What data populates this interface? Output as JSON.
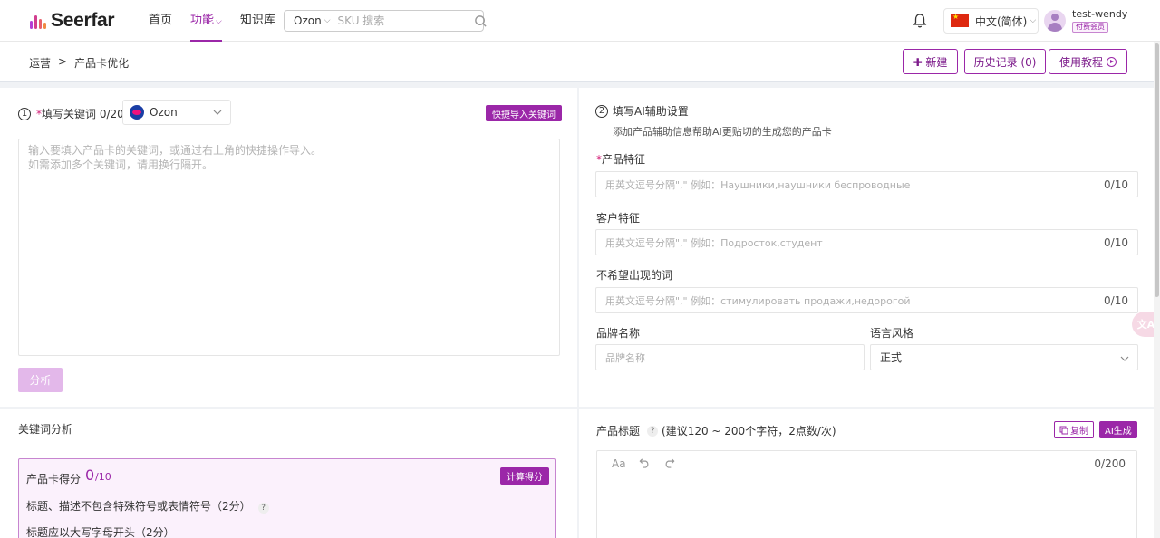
{
  "brand": {
    "name": "Seerfar",
    "colors": {
      "accent": "#9b27a8",
      "logo_bars": [
        "#b43fd6",
        "#d23e8f",
        "#e85f6b",
        "#f08a44"
      ]
    }
  },
  "nav": {
    "items": [
      {
        "label": "首页"
      },
      {
        "label": "功能"
      },
      {
        "label": "知识库"
      }
    ]
  },
  "search": {
    "platform": "Ozon",
    "placeholder": "SKU 搜索"
  },
  "lang": {
    "label": "中文(简体)"
  },
  "user": {
    "name": "test-wendy",
    "badge": "付费会员"
  },
  "breadcrumb": {
    "parent": "运营",
    "separator": ">",
    "current": "产品卡优化"
  },
  "actions": {
    "new": "✚ 新建",
    "history": "历史记录 (0)",
    "tutorial": "使用教程"
  },
  "keywords": {
    "step": "1",
    "required_mark": "*",
    "label": "填写关键词 0/20",
    "platform": "Ozon",
    "quick_import": "快捷导入关键词",
    "placeholder": "输入要填入产品卡的关键词，或通过右上角的快捷操作导入。\n如需添加多个关键词，请用换行隔开。",
    "analyze": "分析"
  },
  "ai_settings": {
    "step": "2",
    "title": "填写AI辅助设置",
    "subtitle": "添加产品辅助信息帮助AI更贴切的生成您的产品卡",
    "product_features": {
      "label": "产品特征",
      "placeholder": "用英文逗号分隔\",\"  例如：Наушники,наушники беспроводные",
      "counter": "0/10"
    },
    "customer_features": {
      "label": "客户特征",
      "placeholder": "用英文逗号分隔\",\"  例如：Подросток,студент",
      "counter": "0/10"
    },
    "unwanted_words": {
      "label": "不希望出现的词",
      "placeholder": "用英文逗号分隔\",\"  例如：стимулировать продажи,недорогой",
      "counter": "0/10"
    },
    "brand": {
      "label": "品牌名称",
      "placeholder": "品牌名称"
    },
    "style": {
      "label": "语言风格",
      "value": "正式"
    }
  },
  "analysis": {
    "title": "关键词分析",
    "score_label": "产品卡得分",
    "score_value": "0",
    "score_max": "/10",
    "calc_button": "计算得分",
    "rules": [
      "标题、描述不包含特殊符号或表情符号（2分）",
      "标题应以大写字母开头（2分）"
    ]
  },
  "product_title": {
    "label": "产品标题",
    "help": "?",
    "hint": "(建议120 ~ 200个字符，2点数/次)",
    "copy": "复制",
    "ai_generate": "AI生成",
    "toolbar_font": "Aa",
    "counter": "0/200"
  },
  "floating": {
    "translate": "文A"
  }
}
